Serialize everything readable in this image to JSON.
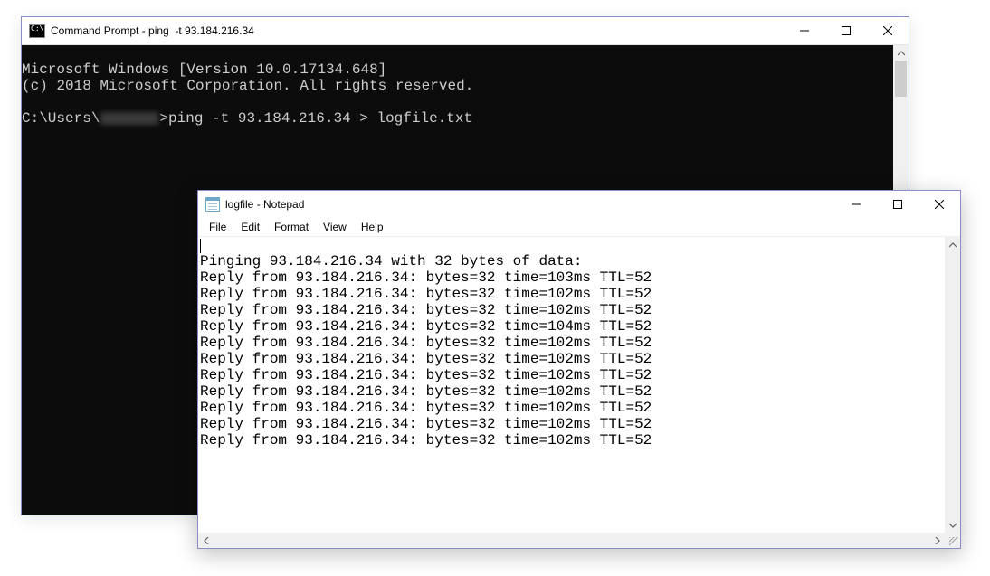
{
  "cmd": {
    "title": "Command Prompt - ping  -t 93.184.216.34",
    "line1": "Microsoft Windows [Version 10.0.17134.648]",
    "line2": "(c) 2018 Microsoft Corporation. All rights reserved.",
    "prompt_prefix": "C:\\Users\\",
    "prompt_suffix": ">",
    "command": "ping -t 93.184.216.34 > logfile.txt"
  },
  "notepad": {
    "title": "logfile - Notepad",
    "menus": {
      "file": "File",
      "edit": "Edit",
      "format": "Format",
      "view": "View",
      "help": "Help"
    },
    "lines": [
      "",
      "Pinging 93.184.216.34 with 32 bytes of data:",
      "Reply from 93.184.216.34: bytes=32 time=103ms TTL=52",
      "Reply from 93.184.216.34: bytes=32 time=102ms TTL=52",
      "Reply from 93.184.216.34: bytes=32 time=102ms TTL=52",
      "Reply from 93.184.216.34: bytes=32 time=104ms TTL=52",
      "Reply from 93.184.216.34: bytes=32 time=102ms TTL=52",
      "Reply from 93.184.216.34: bytes=32 time=102ms TTL=52",
      "Reply from 93.184.216.34: bytes=32 time=102ms TTL=52",
      "Reply from 93.184.216.34: bytes=32 time=102ms TTL=52",
      "Reply from 93.184.216.34: bytes=32 time=102ms TTL=52",
      "Reply from 93.184.216.34: bytes=32 time=102ms TTL=52",
      "Reply from 93.184.216.34: bytes=32 time=102ms TTL=52"
    ]
  }
}
